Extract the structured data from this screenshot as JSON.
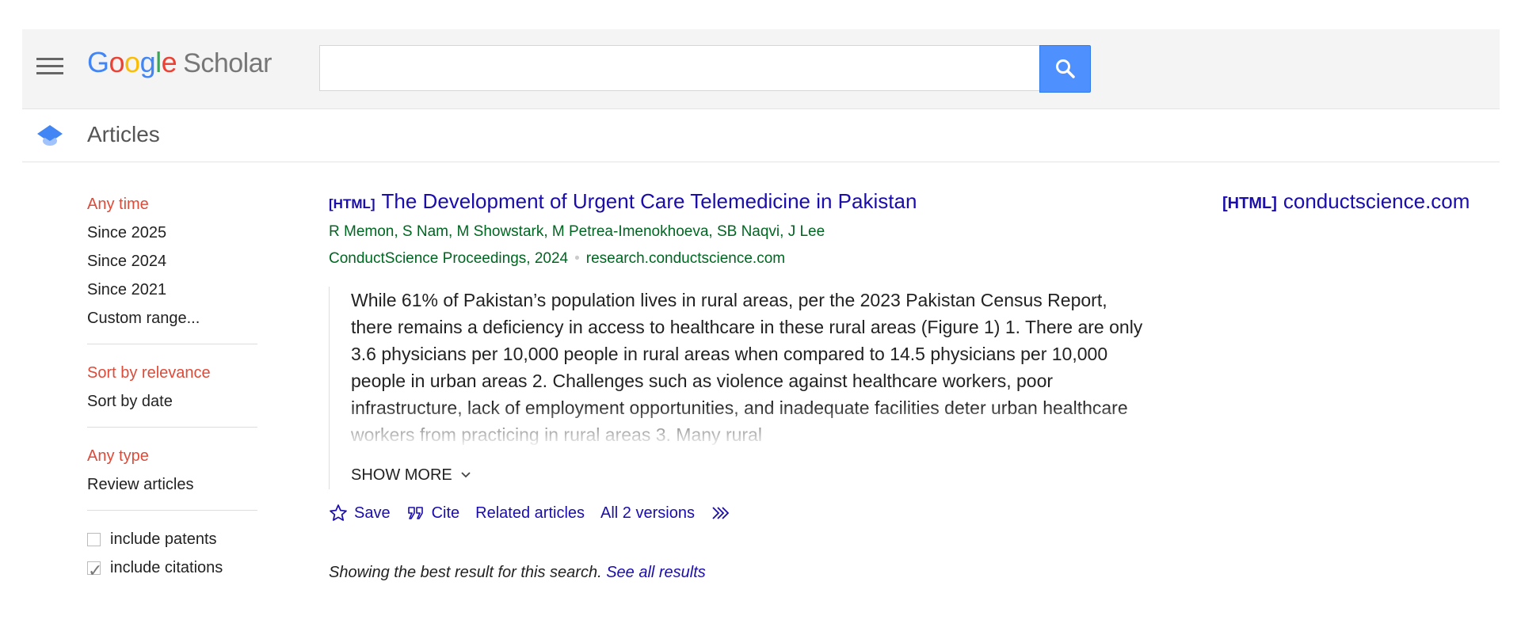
{
  "header": {
    "logo": {
      "g1": "G",
      "o1": "o",
      "o2": "o",
      "g2": "g",
      "l": "l",
      "e": "e",
      "scholar": "Scholar"
    },
    "search_value": "",
    "icons": {
      "menu": "menu-icon",
      "search": "search-icon"
    },
    "accent_color": "#4d90fe"
  },
  "subheader": {
    "label": "Articles",
    "icon": "graduation-cap-icon"
  },
  "sidebar": {
    "time_filters": [
      {
        "label": "Any time",
        "active": true
      },
      {
        "label": "Since 2025",
        "active": false
      },
      {
        "label": "Since 2024",
        "active": false
      },
      {
        "label": "Since 2021",
        "active": false
      },
      {
        "label": "Custom range...",
        "active": false
      }
    ],
    "sort_options": [
      {
        "label": "Sort by relevance",
        "active": true
      },
      {
        "label": "Sort by date",
        "active": false
      }
    ],
    "type_filters": [
      {
        "label": "Any type",
        "active": true
      },
      {
        "label": "Review articles",
        "active": false
      }
    ],
    "checkboxes": [
      {
        "label": "include patents",
        "checked": false
      },
      {
        "label": "include citations",
        "checked": true
      }
    ],
    "active_color": "#dd4b39"
  },
  "result": {
    "format_tag": "[HTML]",
    "title": "The Development of Urgent Care Telemedicine in Pakistan",
    "authors": "R Memon, S Nam, M Showstark, M Petrea-Imenokhoeva, SB Naqvi, J Lee",
    "venue": "ConductScience Proceedings, 2024",
    "domain": "research.conductscience.com",
    "snippet": "While 61% of Pakistan’s population lives in rural areas, per the 2023 Pakistan Census Report, there remains a deficiency in access to healthcare in these rural areas (Figure 1) 1. There are only 3.6 physicians per 10,000 people in rural areas when compared to 14.5 physicians per 10,000 people in urban areas 2. Challenges such as violence against healthcare workers, poor infrastructure, lack of employment opportunities, and inadequate facilities deter urban healthcare workers from practicing in rural areas 3. Many rural",
    "show_more": "SHOW MORE",
    "actions": {
      "save": "Save",
      "cite": "Cite",
      "related": "Related articles",
      "versions": "All 2 versions"
    },
    "link_color": "#1a0dab",
    "meta_color": "#006621"
  },
  "side_link": {
    "tag": "[HTML]",
    "domain": "conductscience.com"
  },
  "footer_note": {
    "text": "Showing the best result for this search.",
    "link": "See all results"
  }
}
